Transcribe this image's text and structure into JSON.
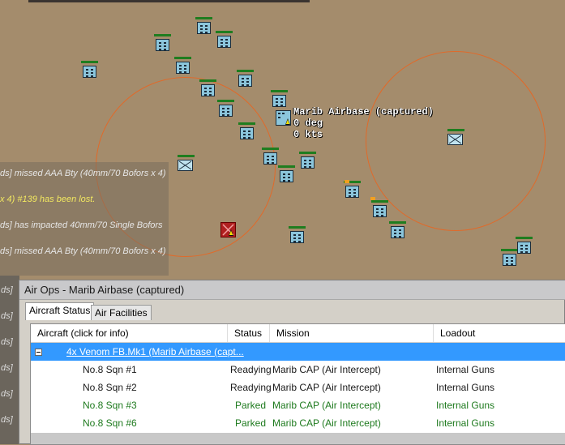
{
  "airbase": {
    "name": "Marib Airbase (captured)",
    "heading": "0 deg",
    "speed": "0 kts"
  },
  "message_log": [
    {
      "text": "ds] missed AAA Bty (40mm/70 Bofors x 4)",
      "color": "#e6e6e6"
    },
    {
      "text": "x 4) #139 has been lost.",
      "color": "#f2e860"
    },
    {
      "text": "ds] has impacted 40mm/70 Single Bofors",
      "color": "#e6e6e6"
    },
    {
      "text": "ds] missed AAA Bty (40mm/70 Bofors x 4)",
      "color": "#e6e6e6"
    }
  ],
  "left_strip": [
    "ds]",
    "ds]",
    "ds]",
    "ds]",
    "ds]",
    "ds]",
    "ds]",
    "ds]"
  ],
  "dialog": {
    "title": "Air Ops - Marib Airbase (captured)",
    "tabs": [
      "Aircraft Status",
      "Air Facilities"
    ],
    "columns": [
      "Aircraft (click for info)",
      "Status",
      "Mission",
      "Loadout"
    ],
    "group": {
      "label": "4x Venom FB.Mk1 (Marib Airbase (capt..."
    },
    "rows": [
      {
        "aircraft": "No.8 Sqn #1",
        "status": "Readying",
        "mission": "Marib CAP (Air Intercept)",
        "loadout": "Internal Guns"
      },
      {
        "aircraft": "No.8 Sqn #2",
        "status": "Readying",
        "mission": "Marib CAP (Air Intercept)",
        "loadout": "Internal Guns"
      },
      {
        "aircraft": "No.8 Sqn #3",
        "status": "Parked",
        "mission": "Marib CAP (Air Intercept)",
        "loadout": "Internal Guns"
      },
      {
        "aircraft": "No.8 Sqn #6",
        "status": "Parked",
        "mission": "Marib CAP (Air Intercept)",
        "loadout": "Internal Guns"
      }
    ]
  },
  "colors": {
    "map_ground": "#a48c6c",
    "range_ring": "#e06a2a",
    "health_bar": "#1f7d1f",
    "selection": "#3399ff",
    "parked_text": "#1e7a1e"
  }
}
